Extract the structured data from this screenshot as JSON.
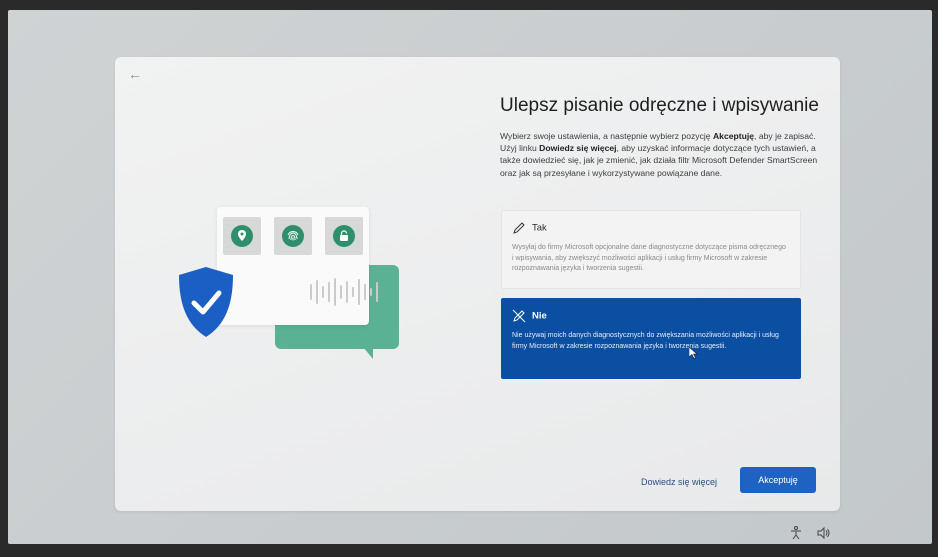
{
  "dialog": {
    "back_icon": "arrow-left-icon",
    "title": "Ulepsz pisanie odręczne i wpisywanie",
    "description": {
      "part1": "Wybierz swoje ustawienia, a następnie wybierz pozycję ",
      "accept_bold": "Akceptuję",
      "part2": ", aby je zapisać. Użyj linku ",
      "link_bold": "Dowiedz się więcej",
      "part3": ", aby uzyskać informacje dotyczące tych ustawień, a także dowiedzieć się, jak je zmienić, jak działa filtr Microsoft Defender SmartScreen oraz jak są przesyłane i wykorzystywane powiązane dane."
    },
    "options": [
      {
        "label": "Tak",
        "icon": "pen-icon",
        "description": "Wysyłaj do firmy Microsoft opcjonalne dane diagnostyczne dotyczące pisma odręcznego i wpisywania, aby zwiększyć możliwości aplikacji i usług firmy Microsoft w zakresie rozpoznawania języka i tworzenia sugestii.",
        "selected": false
      },
      {
        "label": "Nie",
        "icon": "pen-off-icon",
        "description": "Nie używaj moich danych diagnostycznych do zwiększania możliwości aplikacji i usług firmy Microsoft w zakresie rozpoznawania języka i tworzenia sugestii.",
        "selected": true
      }
    ],
    "learn_more": "Dowiedz się więcej",
    "accept": "Akceptuję"
  },
  "illustration": {
    "icons": [
      "location-pin-icon",
      "fingerprint-icon",
      "lock-icon",
      "shield-check-icon",
      "sound-wave-icon"
    ]
  },
  "tray": {
    "icons": [
      "accessibility-icon",
      "speaker-icon"
    ]
  },
  "colors": {
    "accent": "#1e62c4",
    "selected_option": "#0b4fa3",
    "shield": "#1b5fc4",
    "green": "#5bb193"
  }
}
